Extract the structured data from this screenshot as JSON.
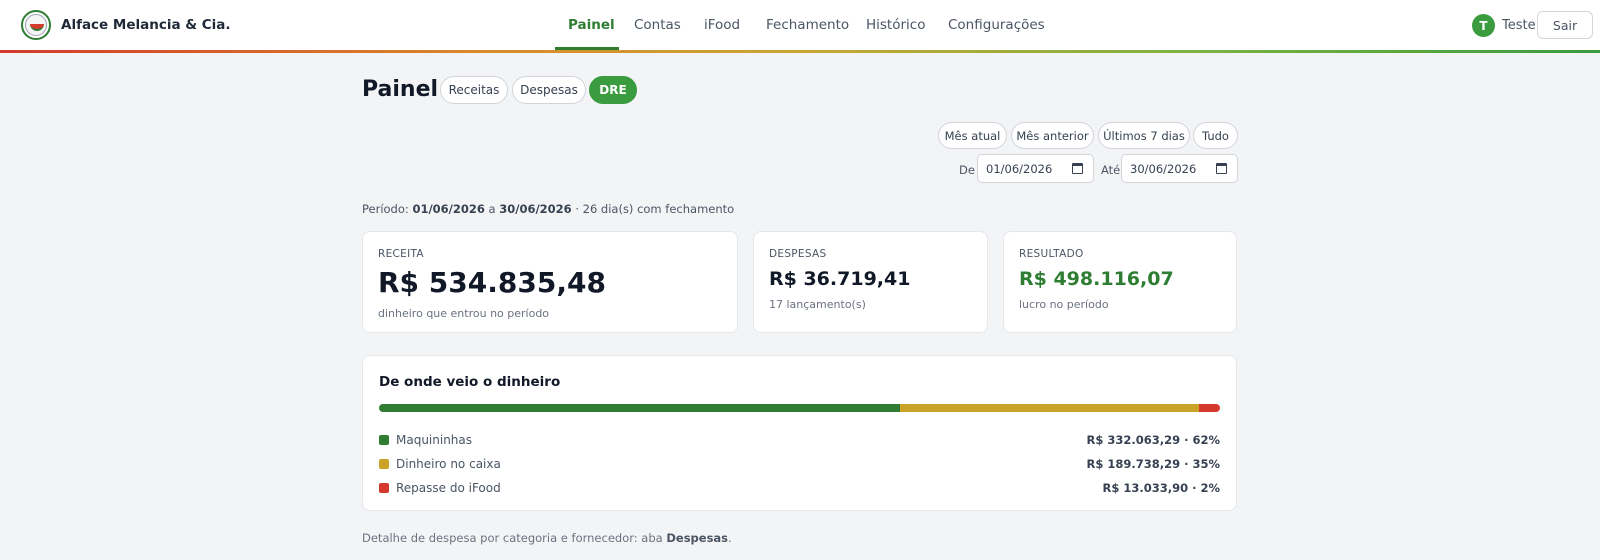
{
  "brand": {
    "name": "Alface Melancia & Cia."
  },
  "nav": {
    "items": [
      {
        "label": "Painel",
        "active": true
      },
      {
        "label": "Contas"
      },
      {
        "label": "iFood"
      },
      {
        "label": "Fechamento"
      },
      {
        "label": "Histórico"
      },
      {
        "label": "Configurações"
      }
    ]
  },
  "user": {
    "initial": "T",
    "name": "Teste",
    "logout_label": "Sair"
  },
  "page": {
    "title": "Painel",
    "views": [
      {
        "label": "Receitas"
      },
      {
        "label": "Despesas"
      },
      {
        "label": "DRE",
        "active": true
      }
    ]
  },
  "filters": {
    "ranges": [
      "Mês atual",
      "Mês anterior",
      "Últimos 7 dias",
      "Tudo"
    ],
    "from_label": "De",
    "from_value": "01/06/2026",
    "to_label": "Até",
    "to_value": "30/06/2026"
  },
  "periodo": {
    "prefix": "Período:",
    "start": "01/06/2026",
    "connector": "a",
    "end": "30/06/2026",
    "suffix": "· 26 dia(s) com fechamento"
  },
  "cards": {
    "receita": {
      "label": "RECEITA",
      "value": "R$ 534.835,48",
      "sub": "dinheiro que entrou no período"
    },
    "despesas": {
      "label": "DESPESAS",
      "value": "R$ 36.719,41",
      "sub": "17 lançamento(s)"
    },
    "resultado": {
      "label": "RESULTADO",
      "value": "R$ 498.116,07",
      "sub": "lucro no período"
    }
  },
  "origem": {
    "title": "De onde veio o dinheiro",
    "items": [
      {
        "label": "Maquininhas",
        "value": "R$ 332.063,29 · 62%",
        "share": 0.62,
        "color": "#2e7d32"
      },
      {
        "label": "Dinheiro no caixa",
        "value": "R$ 189.738,29 · 35%",
        "share": 0.355,
        "color": "#c9a227"
      },
      {
        "label": "Repasse do iFood",
        "value": "R$ 13.033,90 · 2%",
        "share": 0.025,
        "color": "#d33a2c"
      }
    ]
  },
  "footer": {
    "prefix": "Detalhe de despesa por categoria e fornecedor: aba",
    "link": "Despesas",
    "suffix": "."
  },
  "colors": {
    "accent": "#2e7d32",
    "accent_light": "#3a9b3f",
    "expense": "#d33a2c"
  }
}
